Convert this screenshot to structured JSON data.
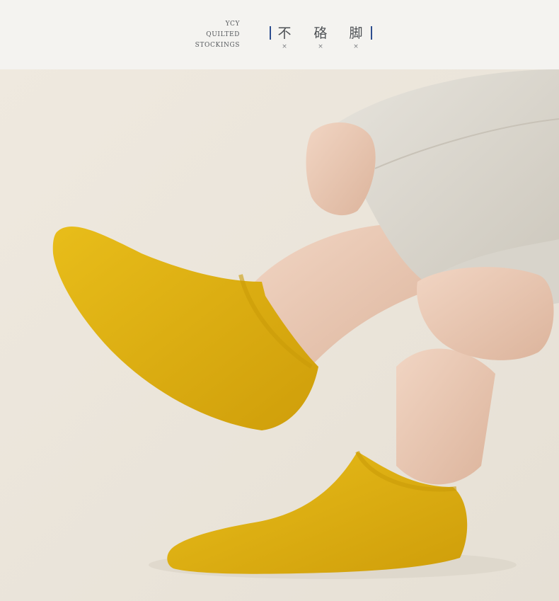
{
  "header": {
    "brand_lines": [
      "YCY",
      "QUILTED",
      "STOCKINGS"
    ],
    "slogan_chars": [
      "不",
      "硌",
      "脚"
    ],
    "separator_glyph": "×",
    "accent_color": "#2c4d8f"
  },
  "photo": {
    "subject": "product-photo",
    "sock_color": "#e0b30f",
    "pants_color": "#dedad2",
    "background_color": "#ece7de"
  }
}
